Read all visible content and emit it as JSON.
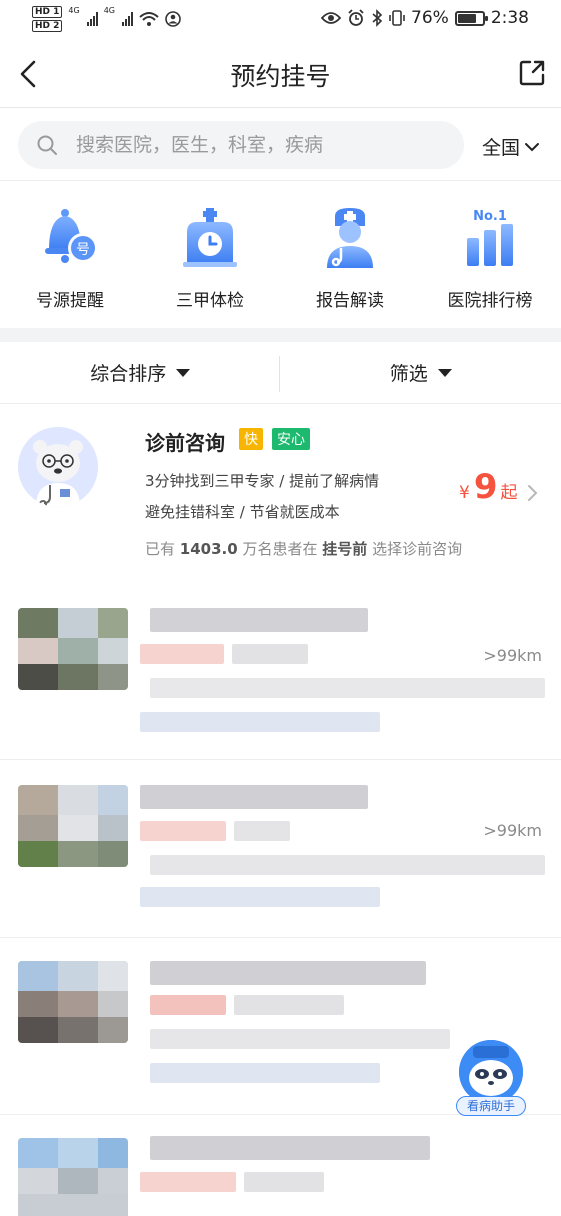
{
  "status_bar": {
    "hd1": "HD 1",
    "hd2": "HD 2",
    "net1": "4G",
    "net2": "4G",
    "battery_text": "76%",
    "battery_level": 0.76,
    "time": "2:38"
  },
  "nav": {
    "title": "预约挂号",
    "back_icon": "chevron-left-icon",
    "share_icon": "share-icon"
  },
  "search": {
    "placeholder": "搜索医院，医生，科室，疾病",
    "region": "全国"
  },
  "quick_entries": [
    {
      "label": "号源提醒",
      "icon": "bell-icon"
    },
    {
      "label": "三甲体检",
      "icon": "clinic-clock-icon"
    },
    {
      "label": "报告解读",
      "icon": "doctor-icon"
    },
    {
      "label": "医院排行榜",
      "icon": "ranking-icon"
    }
  ],
  "sort": {
    "sort_label": "综合排序",
    "filter_label": "筛选"
  },
  "consult": {
    "title": "诊前咨询",
    "tag_fast": "快",
    "tag_safe": "安心",
    "desc1": "3分钟找到三甲专家 / 提前了解病情",
    "desc2": "避免挂错科室 / 节省就医成本",
    "price_symbol": "¥",
    "price_value": "9",
    "price_suffix": "起",
    "stat_prefix": "已有",
    "stat_count": "1403.0",
    "stat_mid": "万名患者在",
    "stat_bold": "挂号前",
    "stat_suffix": "选择诊前咨询"
  },
  "hospitals": [
    {
      "distance": ">99km"
    },
    {
      "distance": ">99km"
    },
    {
      "distance": ""
    },
    {
      "distance": ""
    }
  ],
  "assistant": {
    "label": "看病助手"
  },
  "colors": {
    "accent_blue": "#3d8bf5",
    "price_red": "#f5533d",
    "tag_yellow": "#f7b500",
    "tag_green": "#1cb96e"
  }
}
